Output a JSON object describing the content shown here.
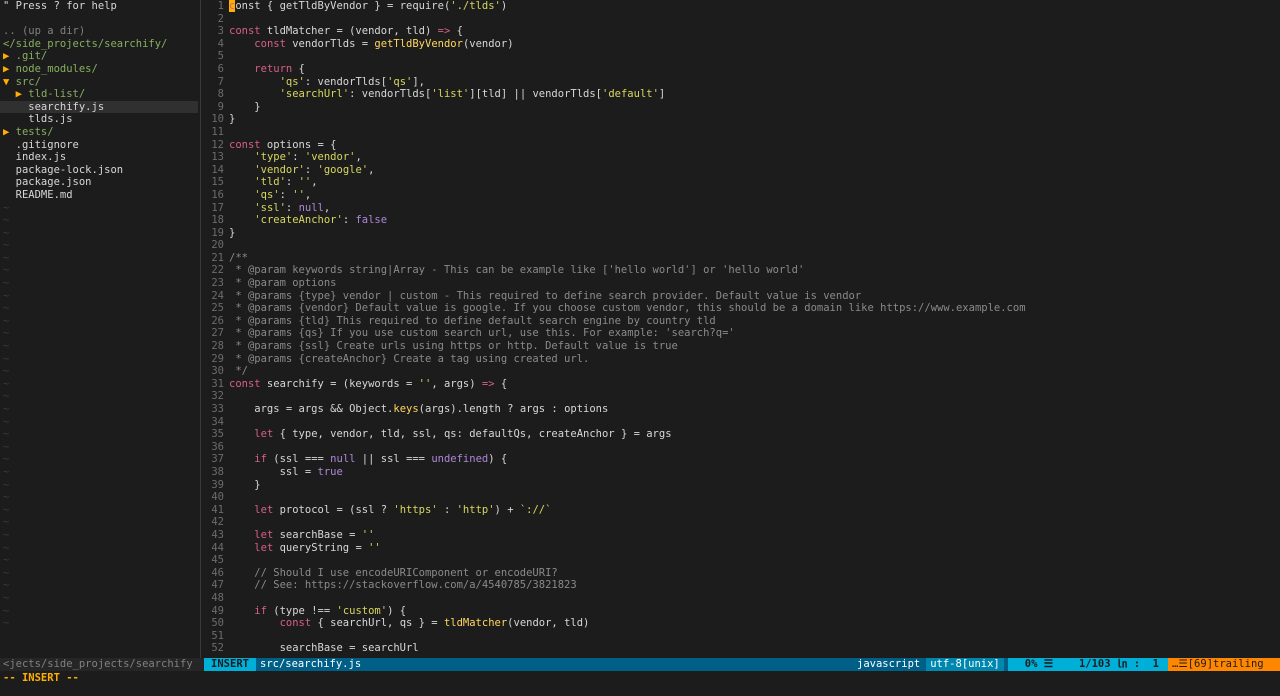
{
  "tree": {
    "help": "\" Press ? for help",
    "updir": ".. (up a dir)",
    "root": "</side_projects/searchify/",
    "items": [
      {
        "text": "▶ .git/",
        "type": "dir"
      },
      {
        "text": "▶ node_modules/",
        "type": "dir"
      },
      {
        "text": "▼ src/",
        "type": "dir"
      },
      {
        "text": "  ▶ tld-list/",
        "type": "dir"
      },
      {
        "text": "    searchify.js",
        "type": "file",
        "current": true
      },
      {
        "text": "    tlds.js",
        "type": "file"
      },
      {
        "text": "▶ tests/",
        "type": "dir"
      },
      {
        "text": "  .gitignore",
        "type": "file"
      },
      {
        "text": "  index.js",
        "type": "file"
      },
      {
        "text": "  package-lock.json",
        "type": "file"
      },
      {
        "text": "  package.json",
        "type": "file"
      },
      {
        "text": "  README.md",
        "type": "file"
      }
    ],
    "tilde": "~",
    "status": "<jects/side_projects/searchify"
  },
  "code_lines": [
    [
      [
        "k",
        "c"
      ],
      [
        "p",
        "onst { getTldByVendor } = require("
      ],
      [
        "s",
        "'./tlds'"
      ],
      [
        "p",
        ")"
      ]
    ],
    [],
    [
      [
        "k",
        "const"
      ],
      [
        "p",
        " tldMatcher = (vendor, tld) "
      ],
      [
        "k",
        "=>"
      ],
      [
        "p",
        " {"
      ]
    ],
    [
      [
        "p",
        "    "
      ],
      [
        "k",
        "const"
      ],
      [
        "p",
        " vendorTlds = "
      ],
      [
        "f",
        "getTldByVendor"
      ],
      [
        "p",
        "(vendor)"
      ]
    ],
    [],
    [
      [
        "p",
        "    "
      ],
      [
        "k",
        "return"
      ],
      [
        "p",
        " {"
      ]
    ],
    [
      [
        "p",
        "        "
      ],
      [
        "s",
        "'qs'"
      ],
      [
        "p",
        ": vendorTlds["
      ],
      [
        "s",
        "'qs'"
      ],
      [
        "p",
        "],"
      ]
    ],
    [
      [
        "p",
        "        "
      ],
      [
        "s",
        "'searchUrl'"
      ],
      [
        "p",
        ": vendorTlds["
      ],
      [
        "s",
        "'list'"
      ],
      [
        "p",
        "][tld] || vendorTlds["
      ],
      [
        "s",
        "'default'"
      ],
      [
        "p",
        "]"
      ]
    ],
    [
      [
        "p",
        "    }"
      ]
    ],
    [
      [
        "p",
        "}"
      ]
    ],
    [],
    [
      [
        "k",
        "const"
      ],
      [
        "p",
        " options = {"
      ]
    ],
    [
      [
        "p",
        "    "
      ],
      [
        "s",
        "'type'"
      ],
      [
        "p",
        ": "
      ],
      [
        "s",
        "'vendor'"
      ],
      [
        "p",
        ","
      ]
    ],
    [
      [
        "p",
        "    "
      ],
      [
        "s",
        "'vendor'"
      ],
      [
        "p",
        ": "
      ],
      [
        "s",
        "'google'"
      ],
      [
        "p",
        ","
      ]
    ],
    [
      [
        "p",
        "    "
      ],
      [
        "s",
        "'tld'"
      ],
      [
        "p",
        ": "
      ],
      [
        "s",
        "''"
      ],
      [
        "p",
        ","
      ]
    ],
    [
      [
        "p",
        "    "
      ],
      [
        "s",
        "'qs'"
      ],
      [
        "p",
        ": "
      ],
      [
        "s",
        "''"
      ],
      [
        "p",
        ","
      ]
    ],
    [
      [
        "p",
        "    "
      ],
      [
        "s",
        "'ssl'"
      ],
      [
        "p",
        ": "
      ],
      [
        "n",
        "null"
      ],
      [
        "p",
        ","
      ]
    ],
    [
      [
        "p",
        "    "
      ],
      [
        "s",
        "'createAnchor'"
      ],
      [
        "p",
        ": "
      ],
      [
        "n",
        "false"
      ]
    ],
    [
      [
        "p",
        "}"
      ]
    ],
    [],
    [
      [
        "c",
        "/**"
      ]
    ],
    [
      [
        "c",
        " * @param keywords string|Array - This can be example like ['hello world'] or 'hello world'"
      ]
    ],
    [
      [
        "c",
        " * @param options"
      ]
    ],
    [
      [
        "c",
        " * @params {type} vendor | custom - This required to define search provider. Default value is vendor"
      ]
    ],
    [
      [
        "c",
        " * @params {vendor} Default value is google. If you choose custom vendor, this should be a domain like https://www.example.com"
      ]
    ],
    [
      [
        "c",
        " * @params {tld} This required to define default search engine by country tld"
      ]
    ],
    [
      [
        "c",
        " * @params {qs} If you use custom search url, use this. For example: 'search?q='"
      ]
    ],
    [
      [
        "c",
        " * @params {ssl} Create urls using https or http. Default value is true"
      ]
    ],
    [
      [
        "c",
        " * @params {createAnchor} Create a tag using created url."
      ]
    ],
    [
      [
        "c",
        " */"
      ]
    ],
    [
      [
        "k",
        "const"
      ],
      [
        "p",
        " searchify = (keywords = "
      ],
      [
        "s",
        "''"
      ],
      [
        "p",
        ", args) "
      ],
      [
        "k",
        "=>"
      ],
      [
        "p",
        " {"
      ]
    ],
    [],
    [
      [
        "p",
        "    args = args && Object."
      ],
      [
        "f",
        "keys"
      ],
      [
        "p",
        "(args).length ? args : options"
      ]
    ],
    [],
    [
      [
        "p",
        "    "
      ],
      [
        "k",
        "let"
      ],
      [
        "p",
        " { type, vendor, tld, ssl, qs: defaultQs, createAnchor } = args"
      ]
    ],
    [],
    [
      [
        "p",
        "    "
      ],
      [
        "k",
        "if"
      ],
      [
        "p",
        " (ssl === "
      ],
      [
        "n",
        "null"
      ],
      [
        "p",
        " || ssl === "
      ],
      [
        "n",
        "undefined"
      ],
      [
        "p",
        ") {"
      ]
    ],
    [
      [
        "p",
        "        ssl = "
      ],
      [
        "n",
        "true"
      ]
    ],
    [
      [
        "p",
        "    }"
      ]
    ],
    [],
    [
      [
        "p",
        "    "
      ],
      [
        "k",
        "let"
      ],
      [
        "p",
        " protocol = (ssl ? "
      ],
      [
        "s",
        "'https'"
      ],
      [
        "p",
        " : "
      ],
      [
        "s",
        "'http'"
      ],
      [
        "p",
        ") + "
      ],
      [
        "s",
        "`://`"
      ]
    ],
    [],
    [
      [
        "p",
        "    "
      ],
      [
        "k",
        "let"
      ],
      [
        "p",
        " searchBase = "
      ],
      [
        "s",
        "''"
      ]
    ],
    [
      [
        "p",
        "    "
      ],
      [
        "k",
        "let"
      ],
      [
        "p",
        " queryString = "
      ],
      [
        "s",
        "''"
      ]
    ],
    [],
    [
      [
        "c",
        "    // Should I use encodeURIComponent or encodeURI?"
      ]
    ],
    [
      [
        "c",
        "    // See: https://stackoverflow.com/a/4540785/3821823"
      ]
    ],
    [],
    [
      [
        "p",
        "    "
      ],
      [
        "k",
        "if"
      ],
      [
        "p",
        " (type !== "
      ],
      [
        "s",
        "'custom'"
      ],
      [
        "p",
        ") {"
      ]
    ],
    [
      [
        "p",
        "        "
      ],
      [
        "k",
        "const"
      ],
      [
        "p",
        " { searchUrl, qs } = "
      ],
      [
        "f",
        "tldMatcher"
      ],
      [
        "p",
        "(vendor, tld)"
      ]
    ],
    [],
    [
      [
        "p",
        "        searchBase = searchUrl"
      ]
    ]
  ],
  "statusline": {
    "mode": "INSERT",
    "file": "src/searchify.js",
    "filetype": "javascript",
    "encoding": "utf-8[unix]",
    "percent": "0% ☰",
    "position": "1/103 ㏑ :  1",
    "trailing": "…☰[69]trailing"
  },
  "cmdline": "-- INSERT --",
  "colors": {
    "background": "#1c1c1c",
    "keyword": "#d75f87",
    "string": "#d7d75f",
    "function": "#ffd75f",
    "comment": "#8a8a8a",
    "constant": "#af87d7",
    "directory": "#87af5f",
    "accent": "#00afd7",
    "warning": "#ff8700"
  }
}
